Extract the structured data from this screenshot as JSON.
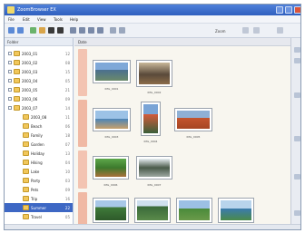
{
  "window": {
    "title": "ZoomBrowser EX"
  },
  "menu": [
    "File",
    "Edit",
    "View",
    "Tools",
    "Help"
  ],
  "toolbar": {
    "view_label": "Zoom"
  },
  "left_pane": {
    "tab_label": "Folder",
    "tree": [
      {
        "label": "2003_01",
        "count": "12"
      },
      {
        "label": "2003_02",
        "count": "08"
      },
      {
        "label": "2003_03",
        "count": "15"
      },
      {
        "label": "2003_04",
        "count": "05"
      },
      {
        "label": "2003_05",
        "count": "21"
      },
      {
        "label": "2003_06",
        "count": "09"
      },
      {
        "label": "2003_07",
        "count": "14"
      },
      {
        "label": "2003_08",
        "count": "11"
      },
      {
        "label": "Beach",
        "count": "06"
      },
      {
        "label": "Family",
        "count": "18"
      },
      {
        "label": "Garden",
        "count": "07"
      },
      {
        "label": "Holiday",
        "count": "13"
      },
      {
        "label": "Hiking",
        "count": "04"
      },
      {
        "label": "Lake",
        "count": "10"
      },
      {
        "label": "Party",
        "count": "03"
      },
      {
        "label": "Pets",
        "count": "09"
      },
      {
        "label": "Trip",
        "count": "16"
      },
      {
        "label": "Summer",
        "count": "22"
      },
      {
        "label": "Travel",
        "count": "05"
      }
    ]
  },
  "main_pane": {
    "tab_label": "Date",
    "photos": [
      {
        "caption": "IMG_0001"
      },
      {
        "caption": "IMG_0002"
      },
      {
        "caption": "IMG_0003"
      },
      {
        "caption": "IMG_0004"
      },
      {
        "caption": "IMG_0005"
      },
      {
        "caption": "IMG_0006"
      },
      {
        "caption": "IMG_0007"
      },
      {
        "caption": "IMG_0008"
      },
      {
        "caption": "IMG_0009"
      },
      {
        "caption": "IMG_0010"
      },
      {
        "caption": "IMG_0011"
      }
    ]
  },
  "colors": {
    "titlebar": "#2f5fbf",
    "selection": "#3d67c4",
    "folder": "#f1c75b",
    "date_strip": "#f0b9a4"
  }
}
